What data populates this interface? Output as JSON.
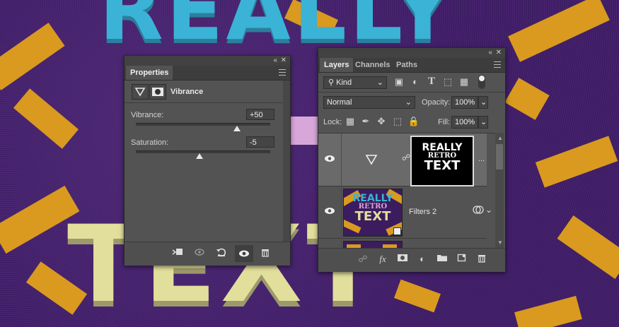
{
  "background_text": {
    "line1": "REALLY",
    "line3": "TEXT"
  },
  "properties": {
    "tab": "Properties",
    "adjustment_title": "Vibrance",
    "vibrance": {
      "label": "Vibrance:",
      "value": "+50",
      "level_percent": 75
    },
    "saturation": {
      "label": "Saturation:",
      "value": "-5",
      "level_percent": 47.5
    },
    "footer_icons": [
      "clip-to-layer-icon",
      "view-previous-state-icon",
      "reset-icon",
      "visibility-icon",
      "trash-icon"
    ]
  },
  "layers": {
    "tabs": [
      "Layers",
      "Channels",
      "Paths"
    ],
    "filter_kind": "Kind",
    "blend_mode": "Normal",
    "opacity_label": "Opacity:",
    "opacity_value": "100%",
    "lock_label": "Lock:",
    "fill_label": "Fill:",
    "fill_value": "100%",
    "mask_thumb_text": {
      "line1": "REALLY",
      "line2": "RETRO",
      "line3": "TEXT"
    },
    "filters_layer_name": "Filters 2",
    "thumb_text": {
      "line1": "REALLY",
      "line2": "RETRO",
      "line3": "TEXT"
    },
    "more_label": "...",
    "footer_icons": [
      "link-icon",
      "fx-icon",
      "mask-icon",
      "adjustment-icon",
      "folder-icon",
      "new-layer-icon",
      "trash-icon"
    ]
  },
  "colors": {
    "panel": "#535353",
    "accent_orange": "#d99a1f",
    "text_blue": "#3bb3d6",
    "text_yellow": "#e2de9c",
    "bg_purple": "#3b1c5e"
  }
}
